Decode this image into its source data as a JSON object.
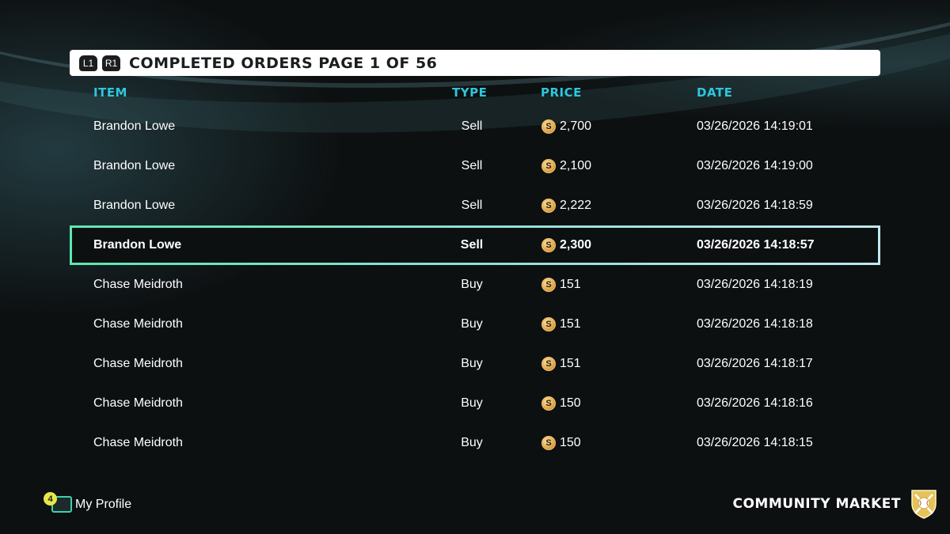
{
  "header": {
    "left_button": "L1",
    "right_button": "R1",
    "title": "COMPLETED ORDERS PAGE 1 OF 56"
  },
  "columns": {
    "item": "ITEM",
    "type": "TYPE",
    "price": "PRICE",
    "date": "DATE"
  },
  "orders": [
    {
      "item": "Brandon Lowe",
      "type": "Sell",
      "price": "2,700",
      "date": "03/26/2026 14:19:01"
    },
    {
      "item": "Brandon Lowe",
      "type": "Sell",
      "price": "2,100",
      "date": "03/26/2026 14:19:00"
    },
    {
      "item": "Brandon Lowe",
      "type": "Sell",
      "price": "2,222",
      "date": "03/26/2026 14:18:59"
    },
    {
      "item": "Brandon Lowe",
      "type": "Sell",
      "price": "2,300",
      "date": "03/26/2026 14:18:57",
      "selected": true
    },
    {
      "item": "Chase Meidroth",
      "type": "Buy",
      "price": "151",
      "date": "03/26/2026 14:18:19"
    },
    {
      "item": "Chase Meidroth",
      "type": "Buy",
      "price": "151",
      "date": "03/26/2026 14:18:18"
    },
    {
      "item": "Chase Meidroth",
      "type": "Buy",
      "price": "151",
      "date": "03/26/2026 14:18:17"
    },
    {
      "item": "Chase Meidroth",
      "type": "Buy",
      "price": "150",
      "date": "03/26/2026 14:18:16"
    },
    {
      "item": "Chase Meidroth",
      "type": "Buy",
      "price": "150",
      "date": "03/26/2026 14:18:15"
    }
  ],
  "coin_icon": {
    "glyph": "S",
    "icon": "stubs-coin-icon"
  },
  "footer": {
    "profile_badge": "4",
    "profile_label": "My Profile",
    "market_label": "COMMUNITY MARKET"
  },
  "colors": {
    "accent": "#2ec6de",
    "selection_border_start": "#5ee7b0",
    "selection_border_end": "#bfe8f0",
    "coin": "#d99a3c"
  }
}
